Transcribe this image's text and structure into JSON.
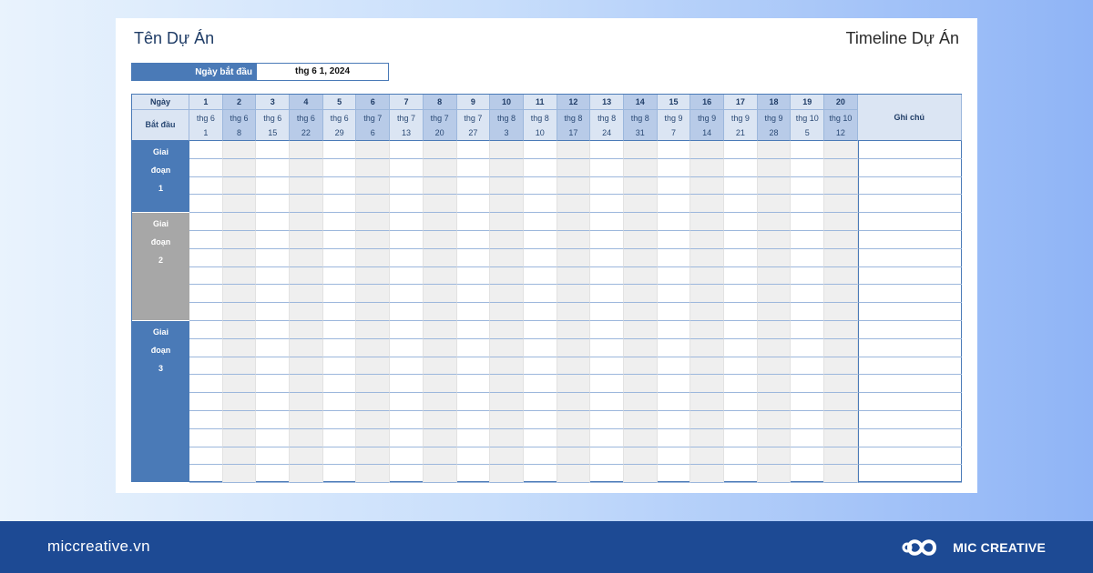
{
  "sheet": {
    "title_left": "Tên Dự Án",
    "title_right": "Timeline Dự Án",
    "start_label": "Ngày bắt đầu",
    "start_value": "thg 6 1, 2024"
  },
  "table": {
    "header_day": "Ngày",
    "header_start": "Bắt đầu",
    "header_note": "Ghi chú",
    "columns": [
      {
        "num": "1",
        "month": "thg 6",
        "day": "1"
      },
      {
        "num": "2",
        "month": "thg 6",
        "day": "8"
      },
      {
        "num": "3",
        "month": "thg 6",
        "day": "15"
      },
      {
        "num": "4",
        "month": "thg 6",
        "day": "22"
      },
      {
        "num": "5",
        "month": "thg 6",
        "day": "29"
      },
      {
        "num": "6",
        "month": "thg 7",
        "day": "6"
      },
      {
        "num": "7",
        "month": "thg 7",
        "day": "13"
      },
      {
        "num": "8",
        "month": "thg 7",
        "day": "20"
      },
      {
        "num": "9",
        "month": "thg 7",
        "day": "27"
      },
      {
        "num": "10",
        "month": "thg 8",
        "day": "3"
      },
      {
        "num": "11",
        "month": "thg 8",
        "day": "10"
      },
      {
        "num": "12",
        "month": "thg 8",
        "day": "17"
      },
      {
        "num": "13",
        "month": "thg 8",
        "day": "24"
      },
      {
        "num": "14",
        "month": "thg 8",
        "day": "31"
      },
      {
        "num": "15",
        "month": "thg 9",
        "day": "7"
      },
      {
        "num": "16",
        "month": "thg 9",
        "day": "14"
      },
      {
        "num": "17",
        "month": "thg 9",
        "day": "21"
      },
      {
        "num": "18",
        "month": "thg 9",
        "day": "28"
      },
      {
        "num": "19",
        "month": "thg 10",
        "day": "5"
      },
      {
        "num": "20",
        "month": "thg 10",
        "day": "12"
      }
    ],
    "phases": [
      {
        "word1": "Giai",
        "word2": "đoạn",
        "number": "1",
        "rows": 4,
        "color": "#4a7ab7"
      },
      {
        "word1": "Giai",
        "word2": "đoạn",
        "number": "2",
        "rows": 6,
        "color": "#a7a7a7"
      },
      {
        "word1": "Giai",
        "word2": "đoạn",
        "number": "3",
        "rows": 9,
        "color": "#4a7ab7"
      }
    ]
  },
  "footer": {
    "url": "miccreative.vn",
    "brand": "MIC CREATIVE",
    "logo_icon": "mic-creative-logo-icon",
    "background": "#1d4a94"
  }
}
